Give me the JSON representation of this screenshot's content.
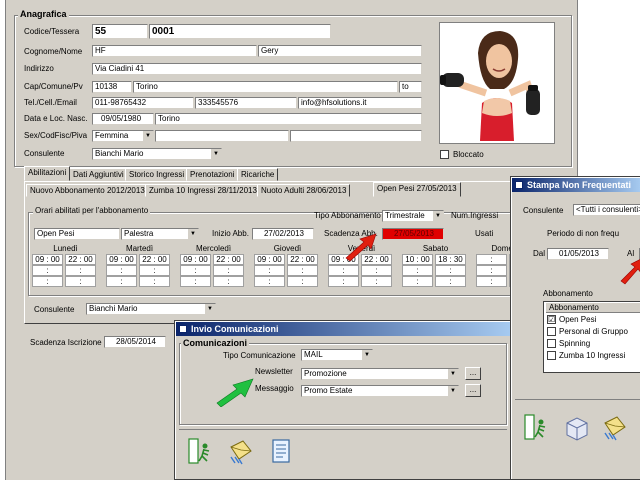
{
  "anagrafica": {
    "title": "Anagrafica",
    "codice_label": "Codice/Tessera",
    "codice_value": "55",
    "tessera_value": "0001",
    "cognome_label": "Cognome/Nome",
    "cognome_value": "HF",
    "nome_value": "Gery",
    "indirizzo_label": "Indirizzo",
    "indirizzo_value": "Via Ciadini 41",
    "cap_label": "Cap/Comune/Pv",
    "cap_value": "10138",
    "comune_value": "Torino",
    "pv_value": "to",
    "tel_label": "Tel./Cell./Email",
    "tel_value": "011-98765432",
    "cell_value": "333545576",
    "email_value": "info@hfsolutions.it",
    "nascita_label": "Data e Loc. Nasc.",
    "nascita_data": "09/05/1980",
    "nascita_loc": "Torino",
    "sex_label": "Sex/CodFisc/Piva",
    "sex_value": "Femmina",
    "consulente_label": "Consulente",
    "consulente_value": "Bianchi Mario",
    "bloccato_label": "Bloccato"
  },
  "tabs": [
    "Abilitazioni",
    "Dati Aggiuntivi",
    "Storico Ingressi",
    "Prenotazioni",
    "Ricariche"
  ],
  "subtabs": [
    "Nuovo Abbonamento 2012/2013",
    "Zumba 10 Ingressi 28/11/2013",
    "Nuoto Adulti 28/06/2013",
    "Open Pesi 27/05/2013"
  ],
  "orari": {
    "group_title": "Orari abilitati per l'abbonamento",
    "tipo_label": "Tipo Abbonamento",
    "tipo_value": "Trimestrale",
    "num_ingressi_label": "Num.Ingressi",
    "abbonamento_value": "Open Pesi",
    "area_value": "Palestra",
    "inizio_label": "Inizio Abb.",
    "inizio_value": "27/02/2013",
    "scadenza_label": "Scadenza Abb.",
    "scadenza_value": "27/05/2013",
    "usati_label": "Usati",
    "days": [
      {
        "name": "Lunedì",
        "from": "09 : 00",
        "to": "22 : 00"
      },
      {
        "name": "Martedì",
        "from": "09 : 00",
        "to": "22 : 00"
      },
      {
        "name": "Mercoledì",
        "from": "09 : 00",
        "to": "22 : 00"
      },
      {
        "name": "Giovedì",
        "from": "09 : 00",
        "to": "22 : 00"
      },
      {
        "name": "Venerdì",
        "from": "09 : 00",
        "to": "22 : 00"
      },
      {
        "name": "Sabato",
        "from": "10 : 00",
        "to": "18 : 30"
      },
      {
        "name": "Domenica",
        "from": ":",
        "to": ":"
      }
    ],
    "consulente_label": "Consulente",
    "consulente_value": "Bianchi Mario"
  },
  "scadenza_iscrizione_label": "Scadenza Iscrizione",
  "scadenza_iscrizione_value": "28/05/2014",
  "invio": {
    "title": "Invio Comunicazioni",
    "group_title": "Comunicazioni",
    "tipo_label": "Tipo Comunicazione",
    "tipo_value": "MAIL",
    "newsletter_label": "Newsletter",
    "newsletter_value": "Promozione",
    "messaggio_label": "Messaggio",
    "messaggio_value": "Promo Estate",
    "ellipsis": "..."
  },
  "stampa": {
    "title": "Stampa Non Frequentati",
    "consulente_label": "Consulente",
    "consulente_value": "<Tutti i consulenti>",
    "periodo_label": "Periodo di non frequ",
    "dal_label": "Dal",
    "dal_value": "01/05/2013",
    "al_label": "Al",
    "abbonamento_label": "Abbonamento",
    "list_header": "Abbonamento",
    "items": [
      {
        "label": "Open Pesi",
        "checked": "☑"
      },
      {
        "label": "Personal di Gruppo",
        "checked": ""
      },
      {
        "label": "Spinning",
        "checked": ""
      },
      {
        "label": "Zumba 10 Ingressi",
        "checked": ""
      }
    ]
  },
  "colors": {
    "window_bg": "#d4d0c8",
    "titlebar_start": "#0a246a",
    "titlebar_end": "#a6caf0",
    "scadenza_bg": "#e00000",
    "arrow_red": "#e02010",
    "arrow_green": "#20c040"
  }
}
